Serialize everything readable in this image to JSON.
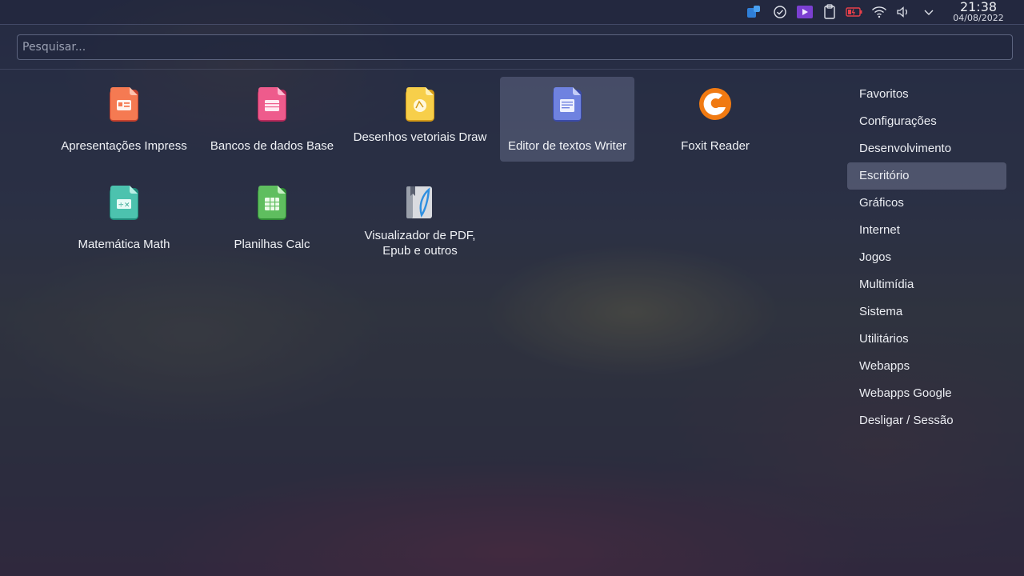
{
  "colors": {
    "panel": "#2a3050",
    "selection": "#7a809f",
    "text": "#f0f2f6"
  },
  "panel": {
    "tray_icons": [
      "bluetooth-app-icon",
      "check-circle-icon",
      "media-player-icon",
      "clipboard-icon",
      "battery-icon",
      "wifi-icon",
      "volume-icon",
      "chevron-down-icon"
    ],
    "time": "21:38",
    "date": "04/08/2022"
  },
  "search": {
    "placeholder": "Pesquisar..."
  },
  "apps": [
    {
      "label": "Apresentações Impress",
      "icon": "impress-icon",
      "color": "#f26b4b"
    },
    {
      "label": "Bancos de dados Base",
      "icon": "base-icon",
      "color": "#e84a7b"
    },
    {
      "label": "Desenhos vetoriais Draw",
      "icon": "draw-icon",
      "color": "#f2c23a"
    },
    {
      "label": "Editor de textos Writer",
      "icon": "writer-icon",
      "color": "#5a6fd0",
      "selected": true
    },
    {
      "label": "Foxit Reader",
      "icon": "foxit-icon",
      "color": "#f07a12"
    },
    {
      "label": "Matemática Math",
      "icon": "math-icon",
      "color": "#3bb3a0"
    },
    {
      "label": "Planilhas Calc",
      "icon": "calc-icon",
      "color": "#4caf50"
    },
    {
      "label": "Visualizador de PDF, Epub e outros",
      "icon": "pdf-viewer-icon",
      "color": "#8a8f99"
    }
  ],
  "categories": [
    {
      "label": "Favoritos"
    },
    {
      "label": "Configurações"
    },
    {
      "label": "Desenvolvimento"
    },
    {
      "label": "Escritório",
      "active": true
    },
    {
      "label": "Gráficos"
    },
    {
      "label": "Internet"
    },
    {
      "label": "Jogos"
    },
    {
      "label": "Multimídia"
    },
    {
      "label": "Sistema"
    },
    {
      "label": "Utilitários"
    },
    {
      "label": "Webapps"
    },
    {
      "label": "Webapps Google"
    },
    {
      "label": "Desligar / Sessão"
    }
  ]
}
